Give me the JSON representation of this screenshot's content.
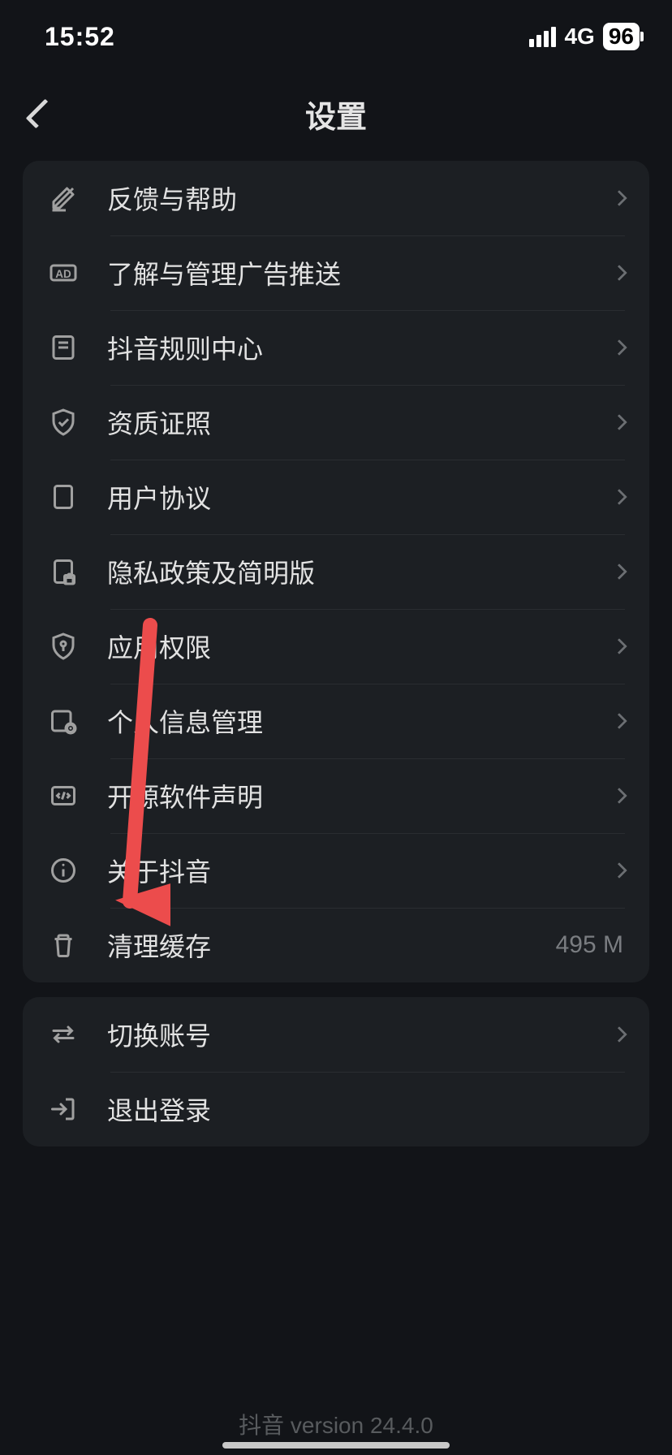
{
  "status": {
    "time": "15:52",
    "network": "4G",
    "battery": "96"
  },
  "header": {
    "title": "设置"
  },
  "group1": {
    "items": [
      {
        "label": "反馈与帮助",
        "icon": "pencil"
      },
      {
        "label": "了解与管理广告推送",
        "icon": "ad"
      },
      {
        "label": "抖音规则中心",
        "icon": "book"
      },
      {
        "label": "资质证照",
        "icon": "shield-check"
      },
      {
        "label": "用户协议",
        "icon": "doc"
      },
      {
        "label": "隐私政策及简明版",
        "icon": "doc-lock"
      },
      {
        "label": "应用权限",
        "icon": "shield-key"
      },
      {
        "label": "个人信息管理",
        "icon": "id-settings"
      },
      {
        "label": "开源软件声明",
        "icon": "code"
      },
      {
        "label": "关于抖音",
        "icon": "info"
      },
      {
        "label": "清理缓存",
        "icon": "trash",
        "value": "495 M",
        "no_chevron": true
      }
    ]
  },
  "group2": {
    "items": [
      {
        "label": "切换账号",
        "icon": "swap"
      },
      {
        "label": "退出登录",
        "icon": "logout",
        "no_chevron": true
      }
    ]
  },
  "footer": {
    "version": "抖音 version 24.4.0"
  }
}
